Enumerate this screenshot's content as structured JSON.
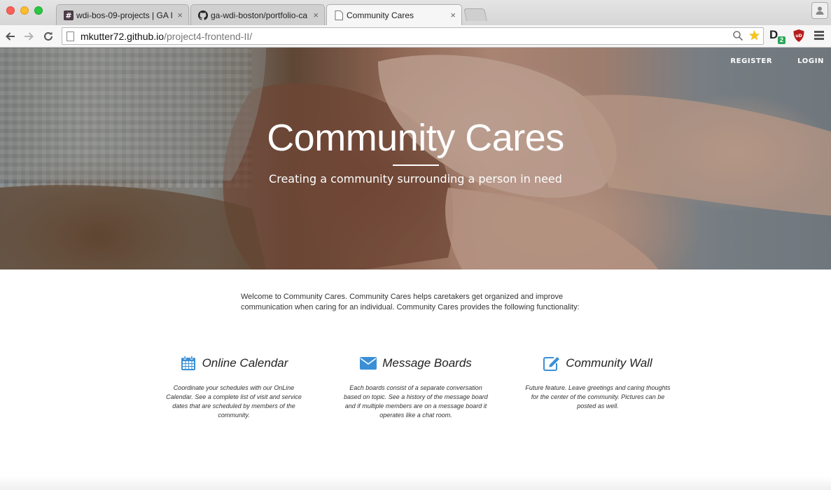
{
  "browser": {
    "tabs": [
      {
        "title": "wdi-bos-09-projects | GA I",
        "favicon": "slack-hash-icon",
        "active": false
      },
      {
        "title": "ga-wdi-boston/portfolio-ca",
        "favicon": "github-icon",
        "active": false
      },
      {
        "title": "Community Cares",
        "favicon": "page-icon",
        "active": true
      }
    ],
    "tab_close_glyph": "×",
    "url": {
      "host": "mkutter72.github.io",
      "path": "/project4-frontend-II/"
    },
    "extension_badge": "2",
    "extension_letter": "D",
    "ublock_label": "uD"
  },
  "hero": {
    "nav": {
      "register": "REGISTER",
      "login": "LOGIN"
    },
    "title": "Community Cares",
    "subtitle": "Creating a community surrounding a person in need"
  },
  "intro": "Welcome to Community Cares. Community Cares helps caretakers get organized and improve communication when caring for an individual. Community Cares provides the following functionality:",
  "features": [
    {
      "icon": "calendar-icon",
      "title": "Online Calendar",
      "description": "Coordinate your schedules with our OnLine Calendar. See a complete list of visit and service dates that are scheduled by members of the community."
    },
    {
      "icon": "envelope-icon",
      "title": "Message Boards",
      "description": "Each boards consist of a separate conversation based on topic. See a history of the message board and if multiple members are on a message board it operates like a chat room."
    },
    {
      "icon": "edit-icon",
      "title": "Community Wall",
      "description": "Future feature. Leave greetings and caring thoughts for the center of the community. Pictures can be posted as well."
    }
  ],
  "colors": {
    "accent": "#3a8fd6",
    "hero_text": "#ffffff",
    "body_text": "#333333"
  }
}
